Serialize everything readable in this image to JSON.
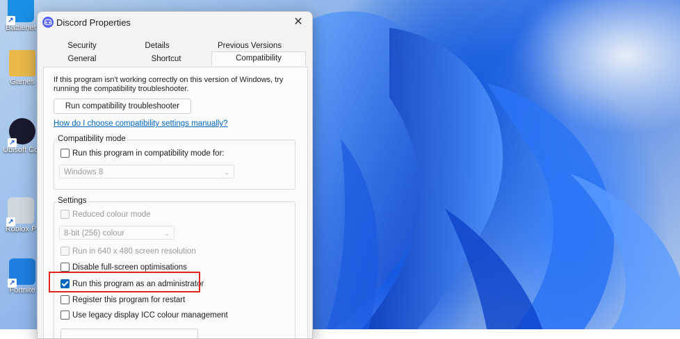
{
  "window": {
    "title": "Discord Properties",
    "close_glyph": "✕"
  },
  "tabs": {
    "row1": [
      "Security",
      "Details",
      "Previous Versions"
    ],
    "row2": [
      "General",
      "Shortcut",
      "Compatibility"
    ],
    "active": "Compatibility"
  },
  "compat": {
    "info_text": "If this program isn't working correctly on this version of Windows, try running the compatibility troubleshooter.",
    "troubleshooter_button": "Run compatibility troubleshooter",
    "manual_link": "How do I choose compatibility settings manually?"
  },
  "compat_mode": {
    "title": "Compatibility mode",
    "checkbox_label": "Run this program in compatibility mode for:",
    "checked": false,
    "select_value": "Windows 8"
  },
  "settings": {
    "title": "Settings",
    "reduced_colour": {
      "label": "Reduced colour mode",
      "checked": false,
      "disabled": true
    },
    "colour_select": "8-bit (256) colour",
    "resolution": {
      "label": "Run in 640 x 480 screen resolution",
      "checked": false,
      "disabled": true
    },
    "fullscreen": {
      "label": "Disable full-screen optimisations",
      "checked": false,
      "disabled": false
    },
    "admin": {
      "label": "Run this program as an administrator",
      "checked": true,
      "disabled": false
    },
    "restart": {
      "label": "Register this program for restart",
      "checked": false,
      "disabled": false
    },
    "icc": {
      "label": "Use legacy display ICC colour management",
      "checked": false,
      "disabled": false
    }
  },
  "desktop_icons": [
    {
      "label": "Battlenet",
      "icon": "battlenet-icon",
      "color": "#1a8fe3"
    },
    {
      "label": "Games",
      "icon": "folder-icon",
      "color": "#e8b84a"
    },
    {
      "label": "Ubisoft Connect",
      "icon": "ubisoft-icon",
      "color": "#1a1a2e"
    },
    {
      "label": "Roblox P",
      "icon": "roblox-icon",
      "color": "#cfd6de"
    },
    {
      "label": "Fortnite",
      "icon": "fortnite-icon",
      "color": "#1f7fe0"
    }
  ],
  "colors": {
    "accent": "#0067c0",
    "highlight_box": "#e0241d",
    "discord": "#5865f2"
  }
}
